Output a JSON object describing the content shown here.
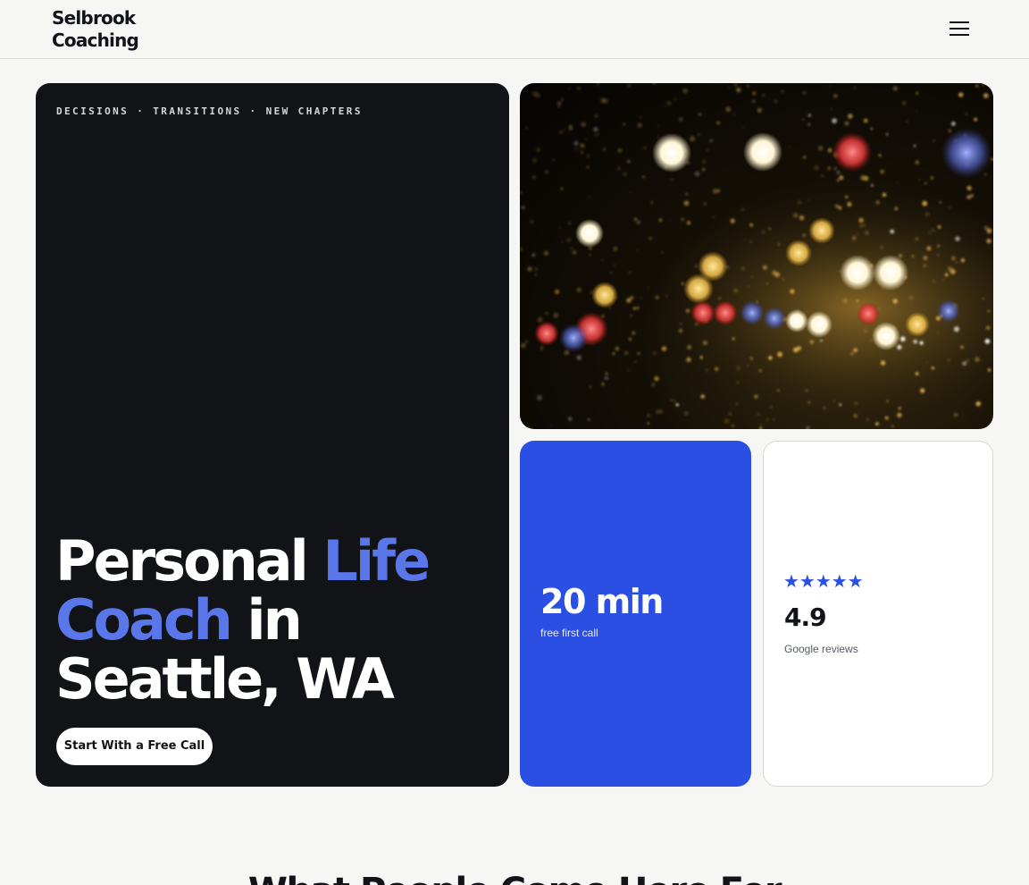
{
  "header": {
    "logo_line1": "Selbrook",
    "logo_line2": "Coaching",
    "menu_icon": "hamburger-menu-icon"
  },
  "hero": {
    "eyebrow": "DECISIONS · TRANSITIONS · NEW CHAPTERS",
    "title_part1": "Personal ",
    "title_accent1": "Life",
    "title_accent2": "Coach",
    "title_part2": " in",
    "title_part3": "Seattle, WA",
    "cta_label": "Start With a Free Call",
    "accent_color": "#5a77ea"
  },
  "photo": {
    "description_icon": "rainy-window-bokeh-photo"
  },
  "stat_card": {
    "value": "20 min",
    "label": "free first call",
    "background": "#2b4fe3"
  },
  "review_card": {
    "stars": "★★★★★",
    "rating": "4.9",
    "label": "Google reviews",
    "star_color": "#2b4fe3"
  },
  "next_section": {
    "heading": "What People Come Here For"
  }
}
